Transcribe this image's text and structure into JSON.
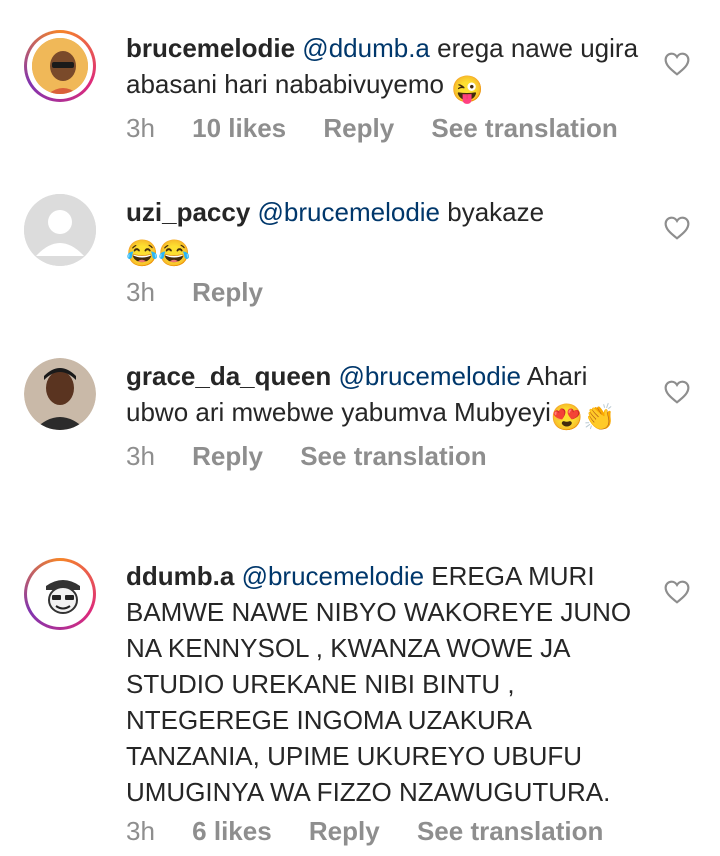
{
  "comments": [
    {
      "username": "brucemelodie",
      "mention": "@ddumb.a",
      "text": "erega nawe ugira abasani hari nababivuyemo",
      "emoji": "😜",
      "time": "3h",
      "likes": "10 likes",
      "reply": "Reply",
      "translate": "See translation"
    },
    {
      "username": "uzi_paccy",
      "mention": "@brucemelodie",
      "text": "byakaze",
      "emoji": "😂😂",
      "time": "3h",
      "reply": "Reply"
    },
    {
      "username": "grace_da_queen",
      "mention": "@brucemelodie",
      "text": "Ahari ubwo ari mwebwe yabumva Mubyeyi",
      "emoji": "😍👏",
      "time": "3h",
      "reply": "Reply",
      "translate": "See translation"
    },
    {
      "username": "ddumb.a",
      "mention": "@brucemelodie",
      "text": "EREGA MURI BAMWE NAWE NIBYO WAKOREYE JUNO NA KENNYSOL , KWANZA WOWE JA STUDIO UREKANE NIBI BINTU , NTEGEREGE INGOMA UZAKURA TANZANIA, UPIME UKUREYO UBUFU UMUGINYA WA FIZZO NZAWUGUTURA.",
      "time": "3h",
      "likes": "6 likes",
      "reply": "Reply",
      "translate": "See translation"
    }
  ],
  "icons": {
    "like": "heart-outline-icon"
  },
  "colors": {
    "mention": "#00376b",
    "meta": "#8e8e8e",
    "text": "#262626"
  }
}
